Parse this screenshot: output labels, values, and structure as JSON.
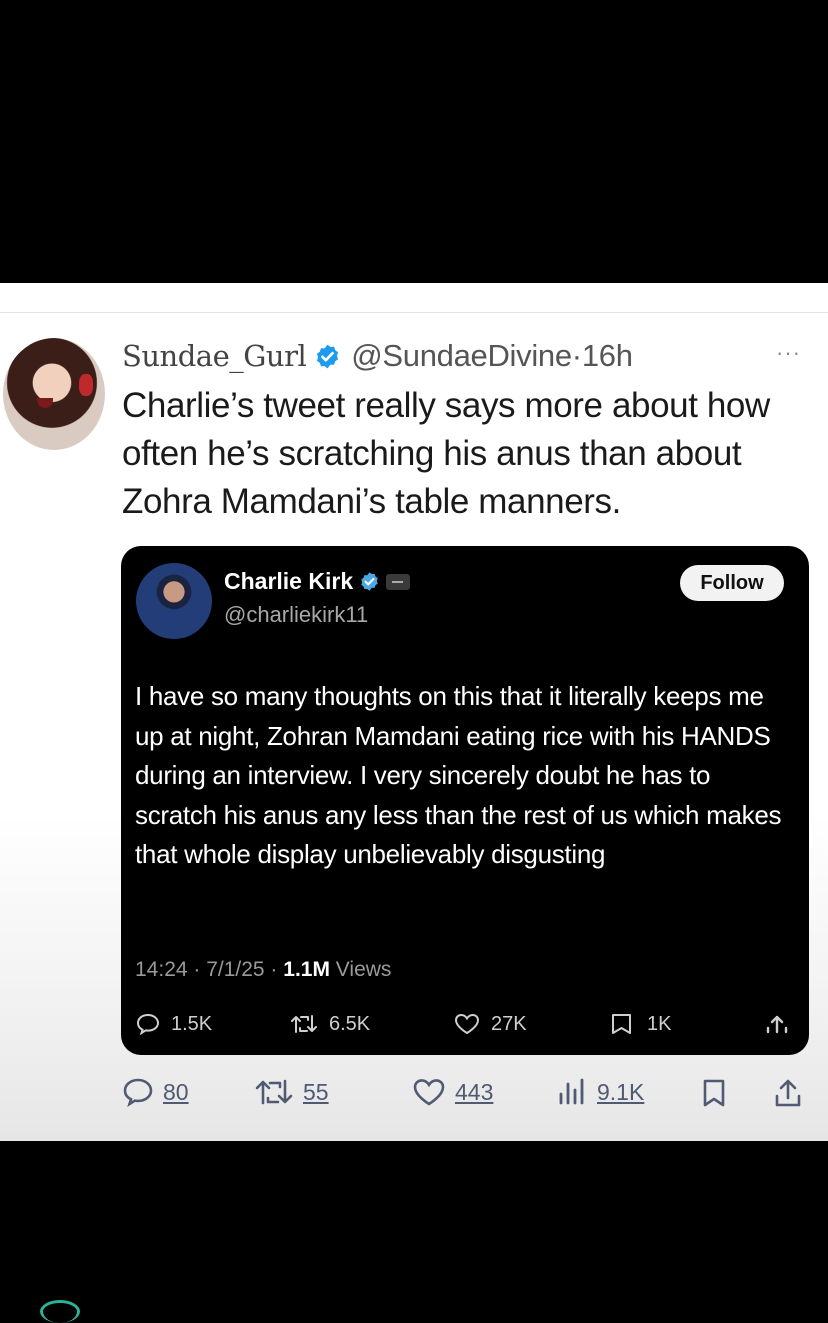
{
  "tweet": {
    "display_name": "Sundae_Gurl",
    "handle_time": "@SundaeDivine·16h",
    "more": "···",
    "text": "Charlie’s tweet really says more about how often he’s scratching his anus than about Zohra Mamdani’s table manners."
  },
  "quoted_tweet": {
    "display_name": "Charlie Kirk",
    "handle": "@charliekirk11",
    "follow_label": "Follow",
    "text": "I have so many thoughts on this that it literally keeps me up at night, Zohran Mamdani eating rice with his HANDS during an interview. I very sincerely doubt he has to scratch his anus any less than the rest of us which makes that whole display unbelievably disgusting",
    "meta_prefix": "14:24 · 7/1/25 · ",
    "views_count": "1.1M",
    "views_label": " Views",
    "replies": "1.5K",
    "reposts": "6.5K",
    "likes": "27K",
    "bookmarks": "1K"
  },
  "actions": {
    "replies": "80",
    "reposts": "55",
    "likes": "443",
    "views": "9.1K"
  },
  "colors": {
    "verified_blue": "#1d9bf0",
    "action_gray": "#505a73",
    "accent_teal": "#2bb39a"
  },
  "icons": [
    "verified-badge-icon",
    "reply-icon",
    "repost-icon",
    "like-icon",
    "views-icon",
    "bookmark-icon",
    "share-icon",
    "more-icon",
    "affiliate-icon"
  ]
}
